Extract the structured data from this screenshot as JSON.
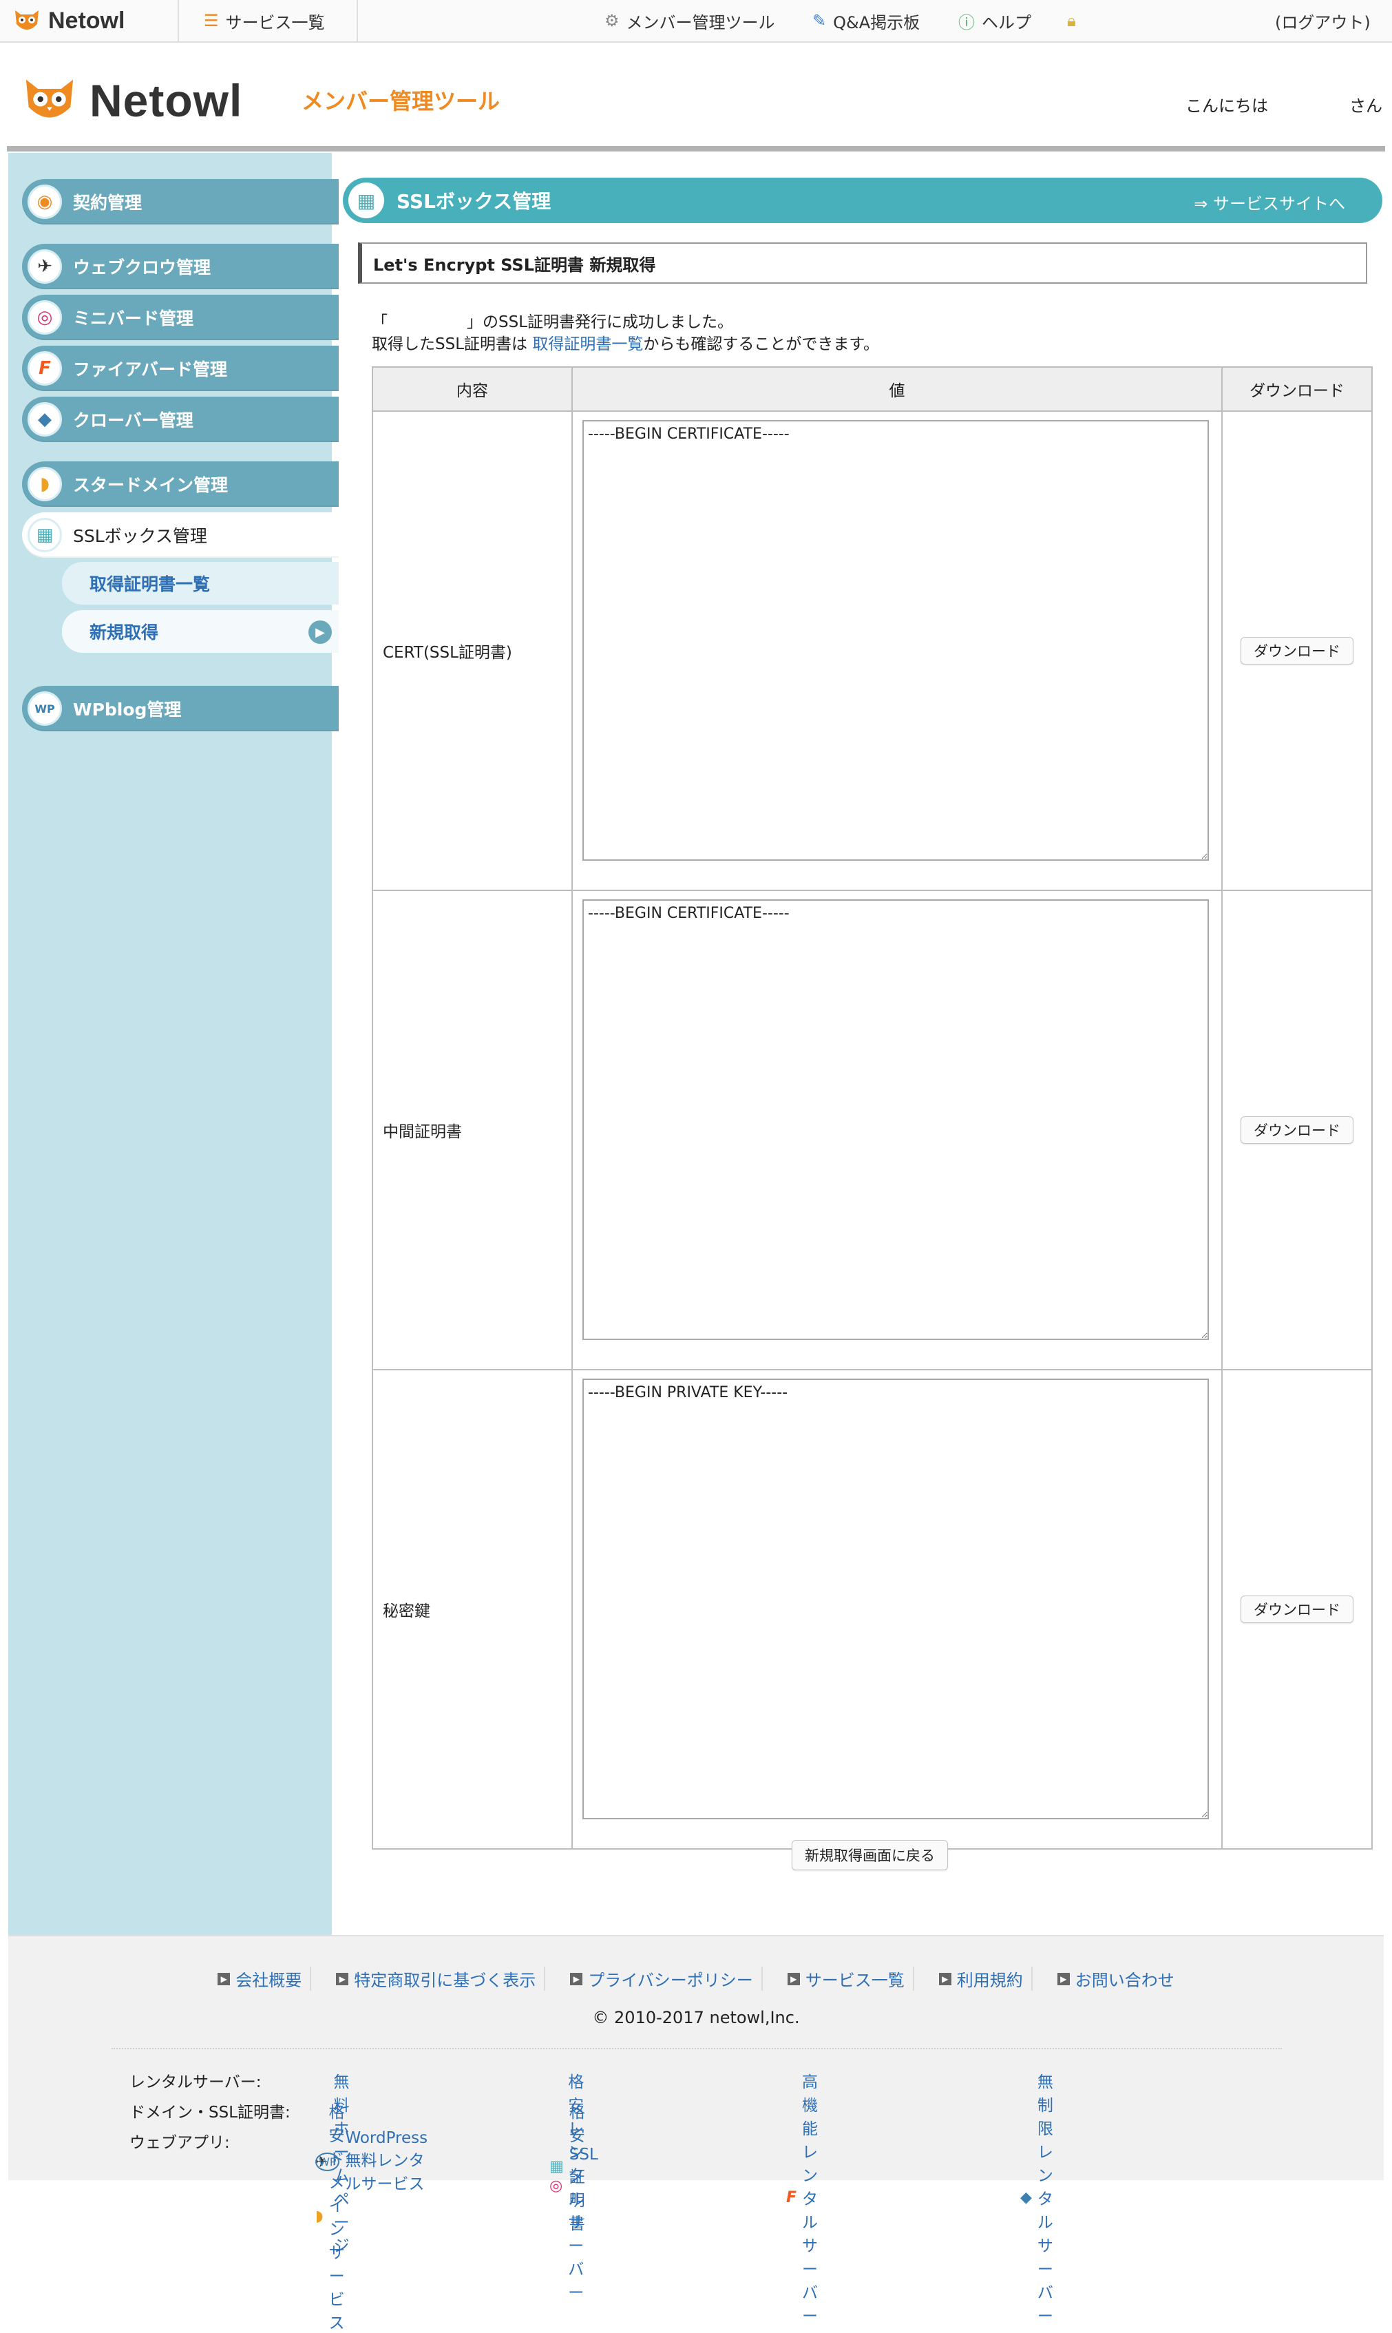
{
  "topbar": {
    "logo_text": "Netowl",
    "services_label": "サービス一覧",
    "member_tool_label": "メンバー管理ツール",
    "qa_label": "Q&A掲示板",
    "help_label": "ヘルプ",
    "logout_label": "(ログアウト)"
  },
  "header": {
    "logo_text": "Netowl",
    "tool_title": "メンバー管理ツール",
    "greeting": "こんにちは",
    "honorific": "さん"
  },
  "sidebar": {
    "items": [
      {
        "label": "契約管理"
      },
      {
        "label": "ウェブクロウ管理"
      },
      {
        "label": "ミニバード管理"
      },
      {
        "label": "ファイアバード管理"
      },
      {
        "label": "クローバー管理"
      },
      {
        "label": "スタードメイン管理"
      },
      {
        "label": "SSLボックス管理"
      },
      {
        "label": "WPblog管理"
      }
    ],
    "sub_items": [
      {
        "label": "取得証明書一覧"
      },
      {
        "label": "新規取得"
      }
    ]
  },
  "content": {
    "bar_title": "SSLボックス管理",
    "bar_link": "⇒ サービスサイトへ",
    "section_title": "Let's Encrypt SSL証明書 新規取得",
    "message1": "「　　　　　」のSSL証明書発行に成功しました。",
    "message2_pre": "取得したSSL証明書は",
    "message2_link": "取得証明書一覧",
    "message2_post": "からも確認することができます。",
    "table": {
      "headers": [
        "内容",
        "値",
        "ダウンロード"
      ],
      "rows": [
        {
          "label": "CERT(SSL証明書)",
          "value": "-----BEGIN CERTIFICATE-----",
          "button": "ダウンロード"
        },
        {
          "label": "中間証明書",
          "value": "-----BEGIN CERTIFICATE-----",
          "button": "ダウンロード"
        },
        {
          "label": "秘密鍵",
          "value": "-----BEGIN PRIVATE KEY-----",
          "button": "ダウンロード"
        }
      ]
    },
    "back_button": "新規取得画面に戻る"
  },
  "footer": {
    "links": [
      "会社概要",
      "特定商取引に基づく表示",
      "プライバシーポリシー",
      "サービス一覧",
      "利用規約",
      "お問い合わせ"
    ],
    "copyright": "© 2010-2017 netowl,Inc.",
    "rental_label": "レンタルサーバー:",
    "domain_label": "ドメイン・SSL証明書:",
    "app_label": "ウェブアプリ:",
    "rental_links": [
      "無料ホームページ",
      "格安レンタルサーバー",
      "高機能レンタルサーバー",
      "無制限レンタルサーバー"
    ],
    "domain_links": [
      "格安ドメインサービス",
      "格安SSL証明書"
    ],
    "app_links": [
      "WordPress無料レンタルサービス"
    ]
  },
  "colors": {
    "accent_orange": "#ef8a20",
    "sidebar_teal": "#6aa9bb",
    "content_bar_teal": "#48b0bb",
    "link_blue": "#2f6fb5"
  }
}
